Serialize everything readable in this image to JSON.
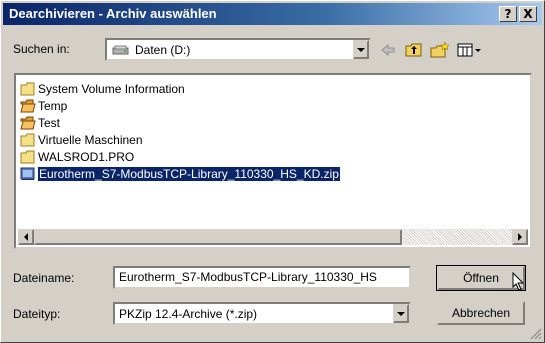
{
  "window": {
    "title": "Dearchivieren - Archiv auswählen",
    "help_button": "?",
    "close_button": "X"
  },
  "look_in": {
    "label": "Suchen in:",
    "value": "Daten (D:)"
  },
  "files": [
    {
      "name": "System Volume Information",
      "icon": "folder-icon",
      "selected": false
    },
    {
      "name": "Temp",
      "icon": "open-folder-icon",
      "selected": false
    },
    {
      "name": "Test",
      "icon": "open-folder-icon",
      "selected": false
    },
    {
      "name": "Virtuelle Maschinen",
      "icon": "folder-icon",
      "selected": false
    },
    {
      "name": "WALSROD1.PRO",
      "icon": "folder-icon",
      "selected": false
    },
    {
      "name": "Eurotherm_S7-ModbusTCP-Library_110330_HS_KD.zip",
      "icon": "zip-file-icon",
      "selected": true
    }
  ],
  "filename": {
    "label": "Dateiname:",
    "value": "Eurotherm_S7-ModbusTCP-Library_110330_HS"
  },
  "filetype": {
    "label": "Dateityp:",
    "value": "PKZip 12.4-Archive (*.zip)"
  },
  "buttons": {
    "open": "Öffnen",
    "cancel": "Abbrechen"
  },
  "colors": {
    "titlebar_start": "#0a246a",
    "selection": "#0a246a",
    "face": "#d4d0c8"
  }
}
